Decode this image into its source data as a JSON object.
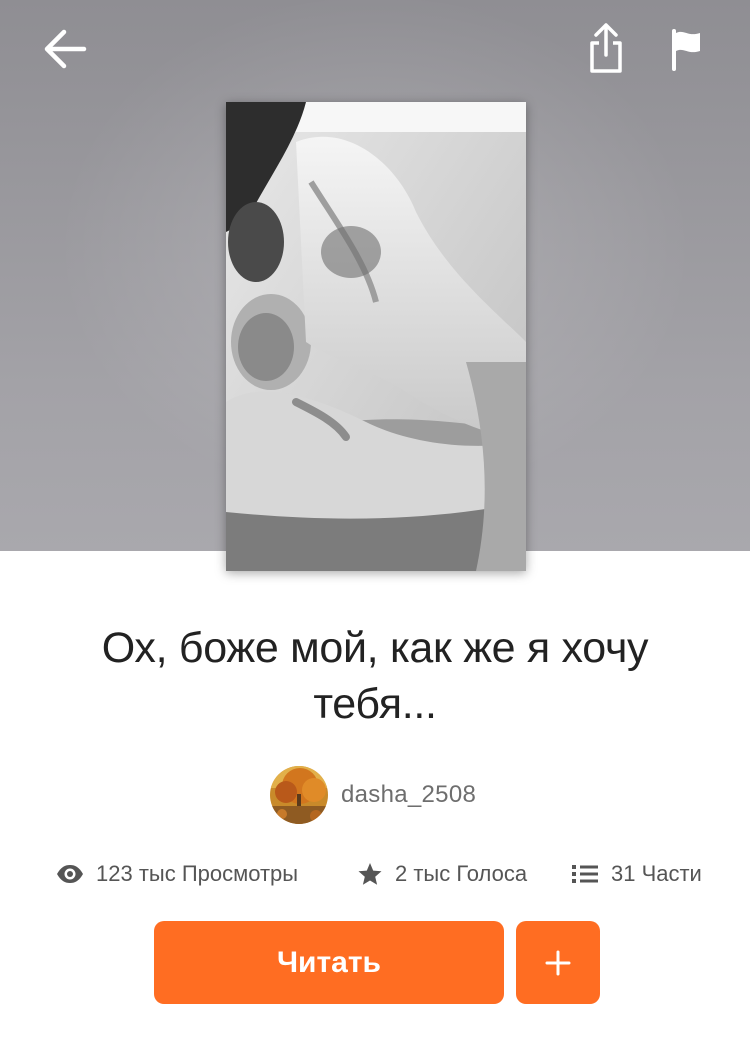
{
  "topbar": {
    "back_icon": "arrow-left-icon",
    "share_icon": "share-icon",
    "report_icon": "flag-icon"
  },
  "story": {
    "cover_image": "black-and-white couple photo cover",
    "title": "Ох, боже мой, как же я хочу тебя...",
    "author": "dasha_2508",
    "avatar_image": "autumn-tree-avatar"
  },
  "stats": {
    "views": "123 тыс Просмотры",
    "votes": "2 тыс Голоса",
    "parts": "31 Части"
  },
  "actions": {
    "read_label": "Читать",
    "add_label": "+"
  },
  "colors": {
    "accent": "#ff6d22",
    "hero_bg": "#9a999e",
    "text_primary": "#222222",
    "text_secondary": "#555555"
  }
}
